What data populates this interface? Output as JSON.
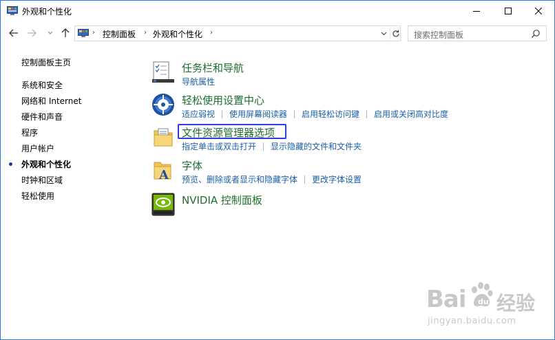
{
  "window": {
    "title": "外观和个性化"
  },
  "address": {
    "crumbs": [
      "控制面板",
      "外观和个性化"
    ]
  },
  "search": {
    "placeholder": "搜索控制面板"
  },
  "sidebar": {
    "items": [
      {
        "label": "控制面板主页"
      },
      {
        "label": "系统和安全"
      },
      {
        "label": "网络和 Internet"
      },
      {
        "label": "硬件和声音"
      },
      {
        "label": "程序"
      },
      {
        "label": "用户帐户"
      },
      {
        "label": "外观和个性化",
        "active": true
      },
      {
        "label": "时钟和区域"
      },
      {
        "label": "轻松使用"
      }
    ]
  },
  "categories": [
    {
      "title": "任务栏和导航",
      "icon": "taskbar-icon",
      "links": [
        "导航属性"
      ]
    },
    {
      "title": "轻松使用设置中心",
      "icon": "ease-of-access-icon",
      "links": [
        "适应弱视",
        "使用屏幕阅读器",
        "启用轻松访问键",
        "启用或关闭高对比度"
      ]
    },
    {
      "title": "文件资源管理器选项",
      "icon": "folder-options-icon",
      "links": [
        "指定单击或双击打开",
        "显示隐藏的文件和文件夹"
      ]
    },
    {
      "title": "字体",
      "icon": "fonts-icon",
      "links": [
        "预览、删除或者显示和隐藏字体",
        "更改字体设置"
      ]
    },
    {
      "title": "NVIDIA 控制面板",
      "icon": "nvidia-icon",
      "links": []
    }
  ],
  "watermark": {
    "brand": "Bai",
    "brand_cn": "经验",
    "url": "jingyan.baidu.com"
  },
  "colors": {
    "category_title": "#1e6e2d",
    "link": "#1a5fa8",
    "highlight_border": "#2c3ee0",
    "window_border": "#2b78d6"
  }
}
